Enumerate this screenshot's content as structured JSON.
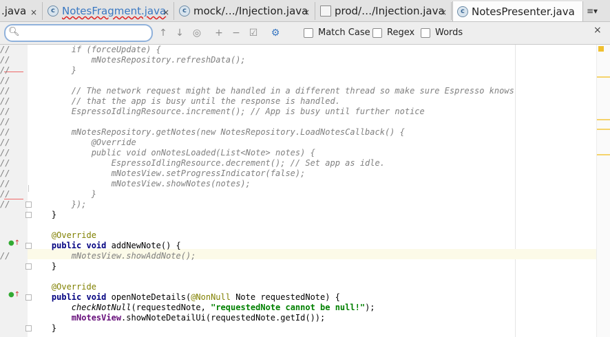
{
  "tabs": [
    {
      "label": ".java",
      "icon": "none",
      "active": false,
      "error": false
    },
    {
      "label": "NotesFragment.java",
      "icon": "class-icon",
      "active": false,
      "error": true
    },
    {
      "label": "mock/…/Injection.java",
      "icon": "class-icon",
      "active": false,
      "error": false
    },
    {
      "label": "prod/…/Injection.java",
      "icon": "java-file-icon",
      "active": false,
      "error": false
    },
    {
      "label": "NotesPresenter.java",
      "icon": "class-icon",
      "active": true,
      "error": false
    }
  ],
  "tab_close_glyph": "×",
  "tab_menu_glyph": "≡▾",
  "class_icon_letter": "c",
  "search": {
    "value": "",
    "options": {
      "match_case": {
        "label": "Match Case",
        "checked": false
      },
      "regex": {
        "label": "Regex",
        "checked": false
      },
      "words": {
        "label": "Words",
        "checked": false
      }
    },
    "close_glyph": "×"
  },
  "colors": {
    "keyword": "#000080",
    "comment": "#808080",
    "annotation": "#808000",
    "string": "#008000",
    "field": "#660e7a",
    "current_line": "#fcfae8",
    "search_border": "#8fb1db"
  },
  "code": {
    "l1": {
      "prefix": "//",
      "text": "        if (forceUpdate) {"
    },
    "l2": {
      "prefix": "//",
      "text": "            mNotesRepository.refreshData();"
    },
    "l3": {
      "prefix": "//",
      "text": "        }"
    },
    "l4": {
      "prefix": "//",
      "text": ""
    },
    "l5": {
      "prefix": "//",
      "text": "        // The network request might be handled in a different thread so make sure Espresso knows"
    },
    "l6": {
      "prefix": "//",
      "text": "        // that the app is busy until the response is handled."
    },
    "l7": {
      "prefix": "//",
      "text": "        EspressoIdlingResource.increment(); // App is busy until further notice"
    },
    "l8": {
      "prefix": "//",
      "text": ""
    },
    "l9": {
      "prefix": "//",
      "text": "        mNotesRepository.getNotes(new NotesRepository.LoadNotesCallback() {"
    },
    "l10": {
      "prefix": "//",
      "text": "            @Override"
    },
    "l11": {
      "prefix": "//",
      "text": "            public void onNotesLoaded(List<Note> notes) {"
    },
    "l12": {
      "prefix": "//",
      "text": "                EspressoIdlingResource.decrement(); // Set app as idle."
    },
    "l13": {
      "prefix": "//",
      "text": "                mNotesView.setProgressIndicator(false);"
    },
    "l14": {
      "prefix": "//",
      "text": "                mNotesView.showNotes(notes);"
    },
    "l15": {
      "prefix": "//",
      "text": "            }"
    },
    "l16": {
      "prefix": "//",
      "text": "        });"
    },
    "l17": {
      "brace": "    }"
    },
    "l19": {
      "ann": "    @Override"
    },
    "l20": {
      "kw": "    public void ",
      "rest": "addNewNote() {"
    },
    "l21": {
      "prefix": "//",
      "text": "        mNotesView.showAddNote();"
    },
    "l22": {
      "brace": "    }"
    },
    "l24": {
      "ann": "    @Override"
    },
    "l25": {
      "kw": "    public void ",
      "name": "openNoteDetails(",
      "ann2": "@NonNull",
      "rest": " Note requestedNote) {"
    },
    "l26": {
      "indent": "        ",
      "call": "checkNotNull",
      "args": "(requestedNote, ",
      "str": "\"requestedNote cannot be null!\"",
      "end": ");"
    },
    "l27": {
      "indent": "        ",
      "field": "mNotesView",
      "rest": ".showNoteDetailUi(requestedNote.getId());"
    },
    "l28": {
      "brace": "    }"
    }
  }
}
